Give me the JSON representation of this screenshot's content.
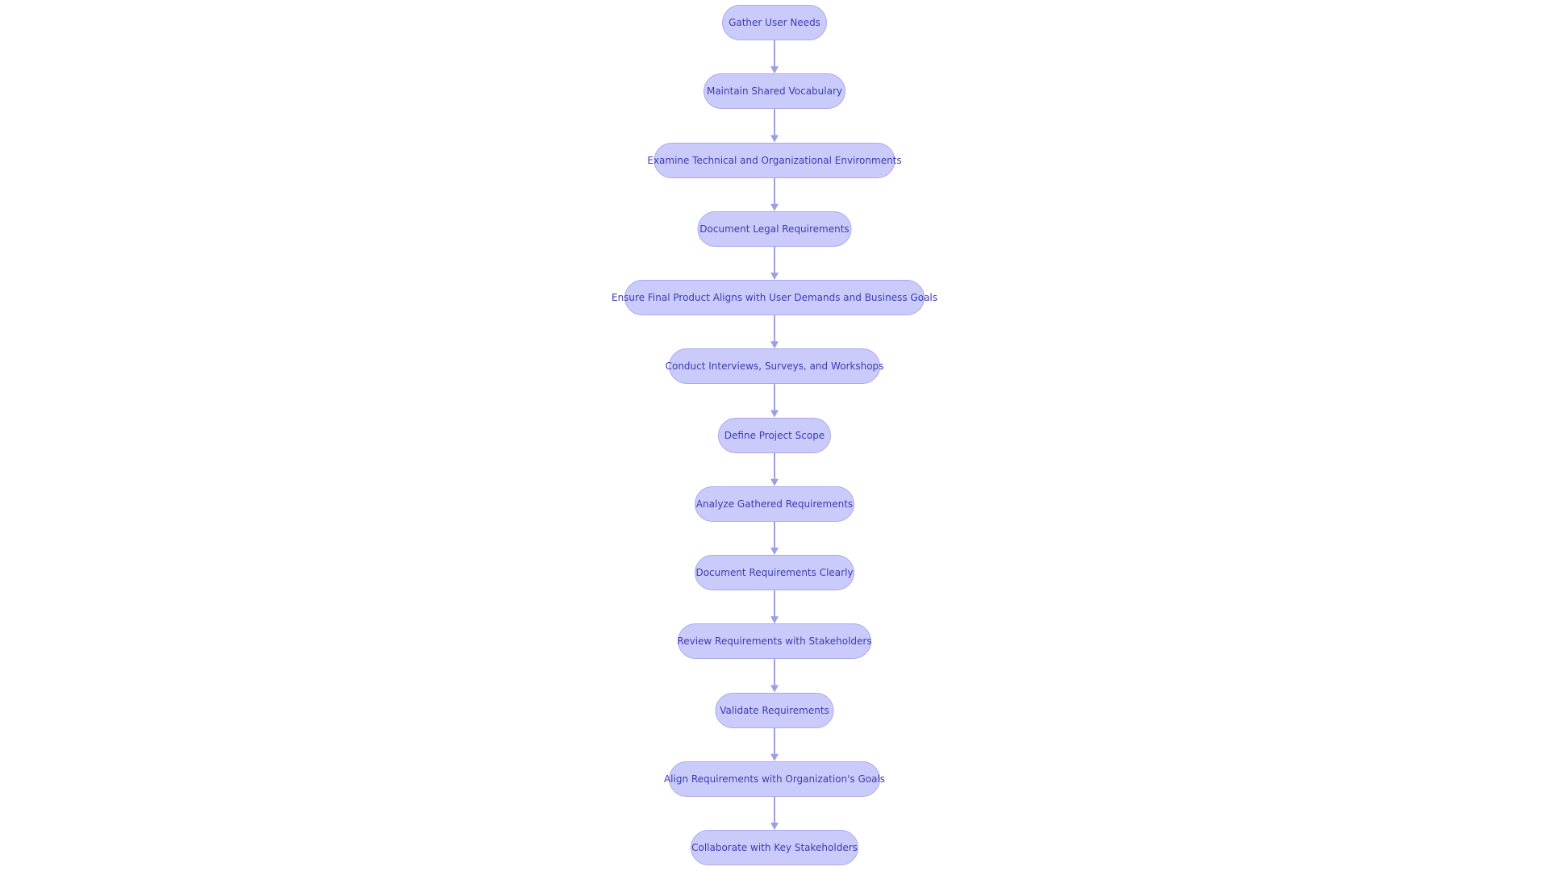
{
  "colors": {
    "node_fill": "#cbcbfb",
    "node_border": "#a9a9ee",
    "text": "#3b3bb0",
    "edge": "#9f9fe0"
  },
  "nodes": [
    "Gather User Needs",
    "Maintain Shared Vocabulary",
    "Examine Technical and Organizational Environments",
    "Document Legal Requirements",
    "Ensure Final Product Aligns with User Demands and Business Goals",
    "Conduct Interviews, Surveys, and Workshops",
    "Define Project Scope",
    "Analyze Gathered Requirements",
    "Document Requirements Clearly",
    "Review Requirements with Stakeholders",
    "Validate Requirements",
    "Align Requirements with Organization's Goals",
    "Collaborate with Key Stakeholders"
  ]
}
